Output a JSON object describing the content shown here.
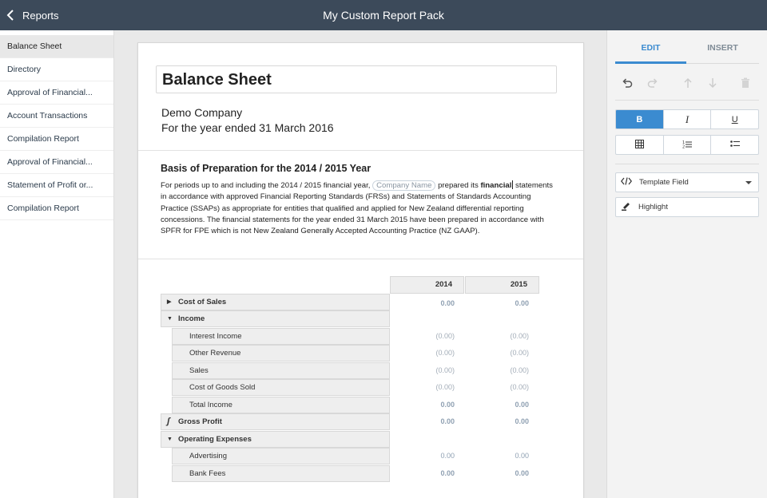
{
  "header": {
    "back_label": "Reports",
    "title": "My Custom Report Pack"
  },
  "sidebar": {
    "items": [
      {
        "label": "Balance Sheet",
        "active": true
      },
      {
        "label": "Directory"
      },
      {
        "label": "Approval of Financial..."
      },
      {
        "label": "Account Transactions"
      },
      {
        "label": "Compilation Report"
      },
      {
        "label": "Approval of Financial..."
      },
      {
        "label": "Statement of Profit or..."
      },
      {
        "label": "Compilation Report"
      }
    ]
  },
  "document": {
    "title": "Balance Sheet",
    "company": "Demo Company",
    "period": "For the year ended 31 March 2016",
    "section_title": "Basis of Preparation for the 2014 / 2015 Year",
    "para_pre": "For periods up to and including the 2014 / 2015 financial year,",
    "para_field": "Company Name",
    "para_mid": "prepared its",
    "para_bold": "financial",
    "para_post": "statements in accordance with approved Financial Reporting Standards (FRSs) and Statements of Standards Accounting Practice (SSAPs) as appropriate for entities that qualified and applied for New Zealand differential reporting concessions. The financial statements for the year ended 31 March 2015 have been prepared in accordance with SPFR for FPE which is not New Zealand Generally Accepted Accounting Practice (NZ GAAP)."
  },
  "table": {
    "years": [
      "2014",
      "2015"
    ],
    "rows": [
      {
        "label": "Cost of Sales",
        "icon": "expand-right-icon",
        "glyph": "▶",
        "v2014": "0.00",
        "v2015": "0.00"
      },
      {
        "label": "Income",
        "icon": "collapse-down-icon",
        "glyph": "▼",
        "v2014": "",
        "v2015": ""
      },
      {
        "label": "Interest Income",
        "v2014": "(0.00)",
        "v2015": "(0.00)"
      },
      {
        "label": "Other Revenue",
        "v2014": "(0.00)",
        "v2015": "(0.00)"
      },
      {
        "label": "Sales",
        "v2014": "(0.00)",
        "v2015": "(0.00)"
      },
      {
        "label": "Cost of Goods Sold",
        "v2014": "(0.00)",
        "v2015": "(0.00)"
      },
      {
        "label": "Total Income",
        "v2014": "0.00",
        "v2015": "0.00"
      },
      {
        "label": "Gross Profit",
        "icon": "formula-icon",
        "glyph": "ʃ",
        "v2014": "0.00",
        "v2015": "0.00"
      },
      {
        "label": "Operating Expenses",
        "icon": "collapse-down-icon",
        "glyph": "▼",
        "v2014": "",
        "v2015": ""
      },
      {
        "label": "Advertising",
        "v2014": "0.00",
        "v2015": "0.00"
      },
      {
        "label": "Bank Fees",
        "v2014": "0.00",
        "v2015": "0.00"
      }
    ]
  },
  "panel": {
    "tab_edit": "EDIT",
    "tab_insert": "INSERT",
    "bold_label": "B",
    "italic_label": "I",
    "underline_label": "U",
    "template_field_label": "Template Field",
    "highlight_label": "Highlight"
  },
  "colors": {
    "header_bg": "#3c4a5a",
    "accent": "#3b8bd0"
  }
}
